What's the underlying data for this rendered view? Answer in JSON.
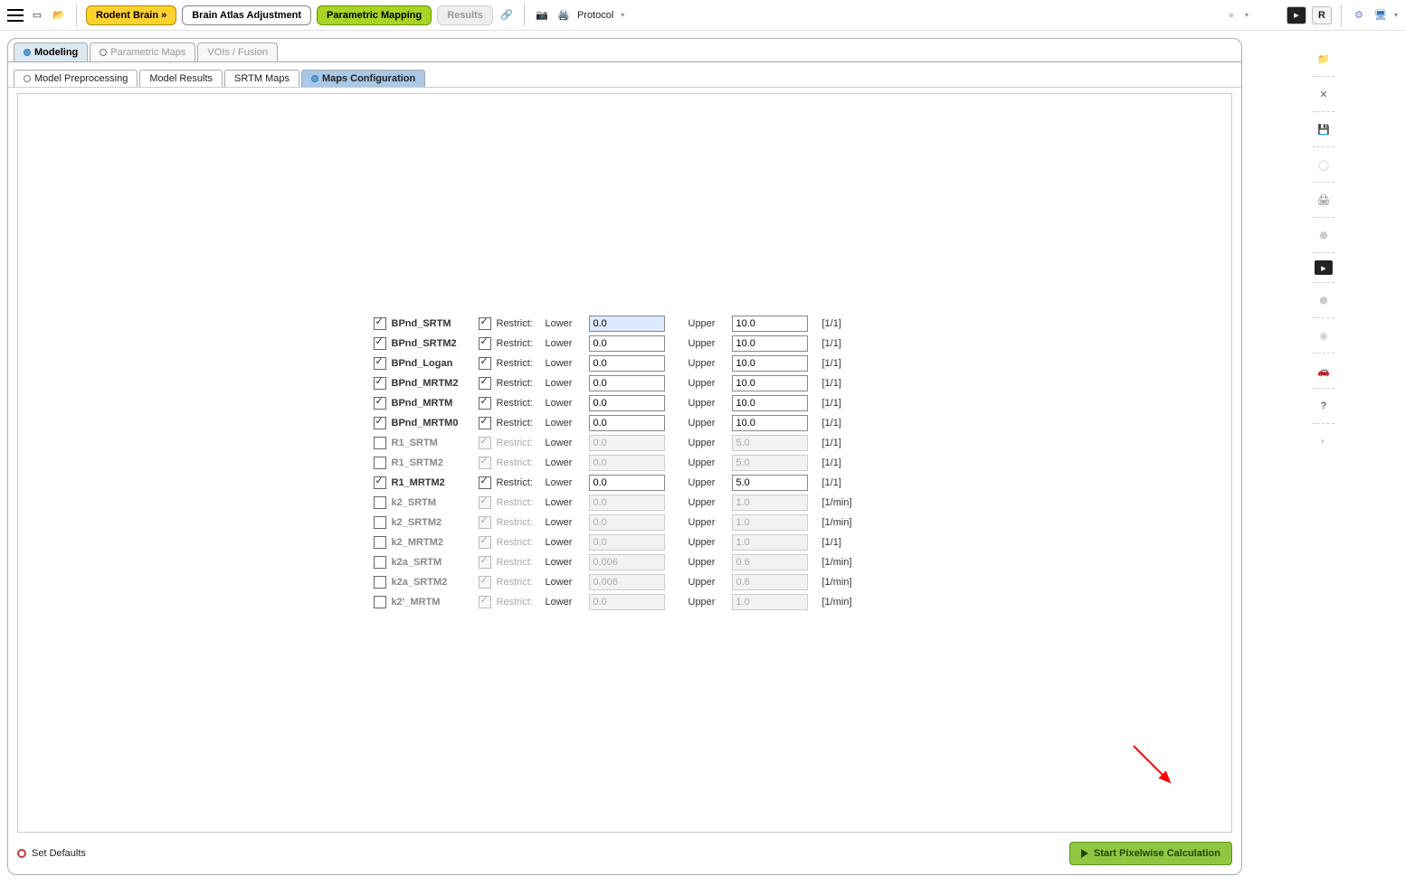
{
  "toolbar": {
    "rodent_brain": "Rodent Brain »",
    "brain_atlas": "Brain Atlas Adjustment",
    "parametric_mapping": "Parametric Mapping",
    "results": "Results",
    "protocol": "Protocol",
    "r_label": "R"
  },
  "tabs": {
    "main": [
      {
        "label": "Modeling",
        "active": true,
        "dot": true
      },
      {
        "label": "Parametric Maps",
        "active": false,
        "dot": true
      },
      {
        "label": "VOIs / Fusion",
        "active": false,
        "dot": false
      }
    ],
    "sub": [
      {
        "label": "Model Preprocessing",
        "active": false,
        "dot": true
      },
      {
        "label": "Model Results",
        "active": false,
        "dot": false
      },
      {
        "label": "SRTM Maps",
        "active": false,
        "dot": false
      },
      {
        "label": "Maps Configuration",
        "active": true,
        "dot": true
      }
    ]
  },
  "labels": {
    "restrict": "Restrict:",
    "lower": "Lower",
    "upper": "Upper",
    "set_defaults": "Set Defaults",
    "start": "Start Pixelwise Calculation"
  },
  "params": [
    {
      "name": "BPnd_SRTM",
      "enabled": true,
      "restrict": true,
      "lower": "0.0",
      "upper": "10.0",
      "unit": "[1/1]",
      "highlight": true
    },
    {
      "name": "BPnd_SRTM2",
      "enabled": true,
      "restrict": true,
      "lower": "0.0",
      "upper": "10.0",
      "unit": "[1/1]"
    },
    {
      "name": "BPnd_Logan",
      "enabled": true,
      "restrict": true,
      "lower": "0.0",
      "upper": "10.0",
      "unit": "[1/1]"
    },
    {
      "name": "BPnd_MRTM2",
      "enabled": true,
      "restrict": true,
      "lower": "0.0",
      "upper": "10.0",
      "unit": "[1/1]"
    },
    {
      "name": "BPnd_MRTM",
      "enabled": true,
      "restrict": true,
      "lower": "0.0",
      "upper": "10.0",
      "unit": "[1/1]"
    },
    {
      "name": "BPnd_MRTM0",
      "enabled": true,
      "restrict": true,
      "lower": "0.0",
      "upper": "10.0",
      "unit": "[1/1]"
    },
    {
      "name": "R1_SRTM",
      "enabled": false,
      "restrict": true,
      "lower": "0.0",
      "upper": "5.0",
      "unit": "[1/1]"
    },
    {
      "name": "R1_SRTM2",
      "enabled": false,
      "restrict": true,
      "lower": "0.0",
      "upper": "5.0",
      "unit": "[1/1]"
    },
    {
      "name": "R1_MRTM2",
      "enabled": true,
      "restrict": true,
      "lower": "0.0",
      "upper": "5.0",
      "unit": "[1/1]"
    },
    {
      "name": "k2_SRTM",
      "enabled": false,
      "restrict": true,
      "lower": "0.0",
      "upper": "1.0",
      "unit": "[1/min]"
    },
    {
      "name": "k2_SRTM2",
      "enabled": false,
      "restrict": true,
      "lower": "0.0",
      "upper": "1.0",
      "unit": "[1/min]"
    },
    {
      "name": "k2_MRTM2",
      "enabled": false,
      "restrict": true,
      "lower": "0.0",
      "upper": "1.0",
      "unit": "[1/1]"
    },
    {
      "name": "k2a_SRTM",
      "enabled": false,
      "restrict": true,
      "lower": "0.006",
      "upper": "0.6",
      "unit": "[1/min]"
    },
    {
      "name": "k2a_SRTM2",
      "enabled": false,
      "restrict": true,
      "lower": "0.006",
      "upper": "0.6",
      "unit": "[1/min]"
    },
    {
      "name": "k2'_MRTM",
      "enabled": false,
      "restrict": true,
      "lower": "0.0",
      "upper": "1.0",
      "unit": "[1/min]"
    }
  ]
}
